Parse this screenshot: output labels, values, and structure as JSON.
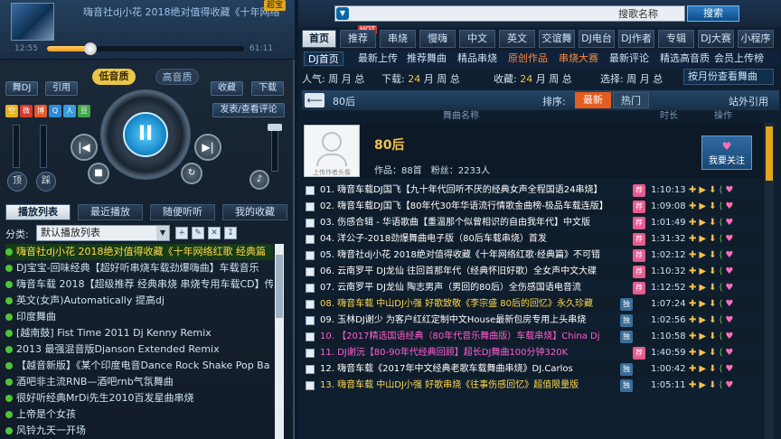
{
  "player": {
    "now_playing": "嗨音社dj小花 2018绝对值得收藏《十年网络",
    "vip_badge": "超宝",
    "time_current": "12:55",
    "time_total": "61:11",
    "progress": 0.22,
    "quality_low": "低音质",
    "quality_high": "高音质",
    "btn_dj": "舞DJ",
    "btn_ref": "引用",
    "btn_fav": "收藏",
    "btn_download": "下载",
    "btn_comment": "发表/查看评论",
    "share_icons": [
      "空",
      "微",
      "博",
      "Q",
      "人",
      "豆"
    ],
    "btn_top": "顶",
    "btn_lyric": "踩",
    "play_symbol": "II",
    "prev_symbol": "|◀",
    "next_symbol": "▶|",
    "stop_symbol": "■",
    "repeat_symbol": "↻",
    "vol_symbol": "♪"
  },
  "left_tabs": [
    "播放列表",
    "最近播放",
    "随便听听",
    "我的收藏"
  ],
  "category": {
    "label": "分类:",
    "value": "默认播放列表"
  },
  "tool_icons": [
    "+",
    "✎",
    "✕",
    "↧"
  ],
  "playlist": [
    "嗨音社dj小花 2018绝对值得收藏《十年网络红歌 经典篇",
    "DJ宝宝-回味经典【超好听串烧车载劲爆嗨曲】车载音乐",
    "嗨音车载 2018【超级推荐 经典串烧 串烧专用车载CD】传",
    "英文(女声)Automatically 提高dj",
    "印度舞曲",
    "[越南鼓] Fist Time 2011 Dj Kenny Remix",
    "2013 最强混音版Djanson Extended Remix",
    "【越音新版】《某个印度电音Dance Rock Shake Pop Ba",
    "酒吧非主流RNB—酒吧rnb气氛舞曲",
    "很好听经典MrDi先生2010百发星曲串烧",
    "上帝是个女孩",
    "风铃九天一开场"
  ],
  "search": {
    "placeholder": "",
    "type": "搜歌名称",
    "button": "搜索"
  },
  "nav_tabs": [
    "首页",
    "推荐",
    "串烧",
    "慢嗨",
    "中文",
    "英文",
    "交谊舞",
    "DJ电台",
    "DJ作者",
    "专辑",
    "DJ大赛",
    "小程序"
  ],
  "hot_badge": "HOT",
  "sub_tabs": [
    "DJ首页",
    "最新上传",
    "推荐舞曲",
    "精品串烧",
    "原创作品",
    "串烧大赛",
    "最新评论",
    "精选高音质",
    "会员上传榜"
  ],
  "stats": {
    "popularity": "人气:",
    "download": "下载:",
    "favorites": "收藏:",
    "sel_period": "选择:",
    "num": "24",
    "unit_week": "周",
    "unit_month": "月",
    "unit_total": "总",
    "sort_select": "按月份查看舞曲"
  },
  "sort_bar": {
    "title": "80后",
    "label": "排序:",
    "newest": "最新",
    "hot": "热门",
    "external": "站外引用"
  },
  "columns": {
    "name": "舞曲名称",
    "duration": "时长",
    "actions": "操作"
  },
  "artist": {
    "name": "80后",
    "photo_caption": "上传作者头像",
    "meta": "作品：88首　粉丝：2233人",
    "follow": "我要关注"
  },
  "songs": [
    {
      "name": "01. 嗨音车载DJ国飞【九十年代回听不厌的经典女声全程国语24串烧】",
      "dur": "1:10:13",
      "tag": "荐",
      "color": "#ffffff"
    },
    {
      "name": "02. 嗨音车载DJ国飞【80年代30年华语流行情歌金曲榜-极品车载连版】",
      "dur": "1:09:08",
      "tag": "荐",
      "color": "#ffffff"
    },
    {
      "name": "03. 伤感合辑 - 华语歌曲【重温那个似曾相识的自由我年代】中文版",
      "dur": "1:01:49",
      "tag": "荐",
      "color": "#ffffff"
    },
    {
      "name": "04. 洋公子-2018劲爆舞曲电子版（80后车载串烧）首发",
      "dur": "1:31:32",
      "tag": "荐",
      "color": "#ffffff"
    },
    {
      "name": "05. 嗨音社dj小花 2018绝对值得收藏《十年网络红歌·经典篇》不可错",
      "dur": "1:02:12",
      "tag": "荐",
      "color": "#ffffff"
    },
    {
      "name": "06. 云南罗平 DJ龙仙 往回首那年代（经典怀旧好歌）全女声中文大碟",
      "dur": "1:10:32",
      "tag": "荐",
      "color": "#ffffff"
    },
    {
      "name": "07. 云南罗平 DJ龙仙 陶志男声（男回的80后）全伤感国语电音流",
      "dur": "1:12:52",
      "tag": "荐",
      "color": "#ffffff"
    },
    {
      "name": "08. 嗨音车载 中山DJ小强 好歌致敬《李宗盛 80后的回忆》永久珍藏",
      "dur": "1:07:24",
      "tag": "独",
      "color": "#ffd94a"
    },
    {
      "name": "09. 玉林DJ谢少 为客户红红定制中文House最新包房专用上头串烧",
      "dur": "1:02:56",
      "tag": "独",
      "color": "#ffffff"
    },
    {
      "name": "10. 【2017精选国语经典（80年代音乐舞曲版）车载串烧】China Dj",
      "dur": "1:10:58",
      "tag": "独",
      "color": "#ff5fd1"
    },
    {
      "name": "11. DJ谢沅【80-90年代经典回顾】超长DJ舞曲100分钟320K",
      "dur": "1:40:59",
      "tag": "荐",
      "color": "#ff5fd1"
    },
    {
      "name": "12. 嗨音车载《2017年中文经典老歌车载舞曲串烧》DJ.Carlos",
      "dur": "1:00:42",
      "tag": "独",
      "color": "#ffffff"
    },
    {
      "name": "13. 嗨音车载 中山DJ小强 好歌串烧《往事伤感回忆》超值限量版",
      "dur": "1:05:11",
      "tag": "独",
      "color": "#ffd94a"
    }
  ],
  "colors": {
    "accent": "#e8c54a",
    "orange": "#e35d1e",
    "panel": "#101f30",
    "rec_tag": "#e85b8d",
    "solo_tag": "#3a6e98"
  }
}
